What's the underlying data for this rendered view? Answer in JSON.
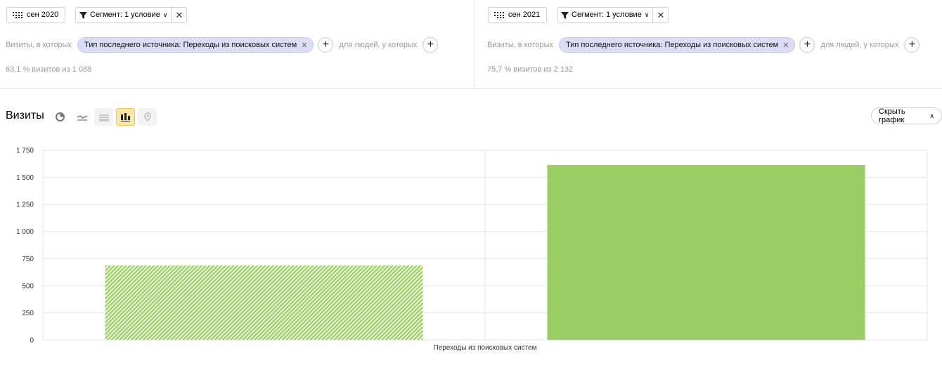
{
  "panels": [
    {
      "date": "сен 2020",
      "segment_label": "Сегмент:",
      "segment_value": "1 условие",
      "visits_prefix": "Визиты, в которых",
      "chip": "Тип последнего источника: Переходы из поисковых систем",
      "people_text": "для людей, у которых",
      "stat": "63,1 % визитов из 1 088"
    },
    {
      "date": "сен 2021",
      "segment_label": "Сегмент:",
      "segment_value": "1 условие",
      "visits_prefix": "Визиты, в которых",
      "chip": "Тип последнего источника: Переходы из поисковых систем",
      "people_text": "для людей, у которых",
      "stat": "75,7 % визитов из 2 132"
    }
  ],
  "view": {
    "title": "Визиты",
    "hide_chart": "Скрыть график",
    "tools": [
      "pie-chart-icon",
      "line-chart-icon",
      "stacked-area-icon",
      "bar-chart-icon",
      "map-icon"
    ],
    "active_tool": "bar-chart-icon"
  },
  "colors": {
    "bar": "#9acd63",
    "chip_bg": "#dcdcf5",
    "active_tool": "#fde7a6"
  },
  "chart_data": {
    "type": "bar",
    "categories": [
      "Переходы из поисковых систем"
    ],
    "series": [
      {
        "name": "сен 2020",
        "values": [
          686
        ],
        "pattern": "hatched"
      },
      {
        "name": "сен 2021",
        "values": [
          1614
        ],
        "pattern": "solid"
      }
    ],
    "ylim": [
      0,
      1750
    ],
    "yticks": [
      0,
      250,
      500,
      750,
      1000,
      1250,
      1500,
      1750
    ],
    "ytick_labels": [
      "0",
      "250",
      "500",
      "750",
      "1 000",
      "1 250",
      "1 500",
      "1 750"
    ],
    "grid": true
  }
}
